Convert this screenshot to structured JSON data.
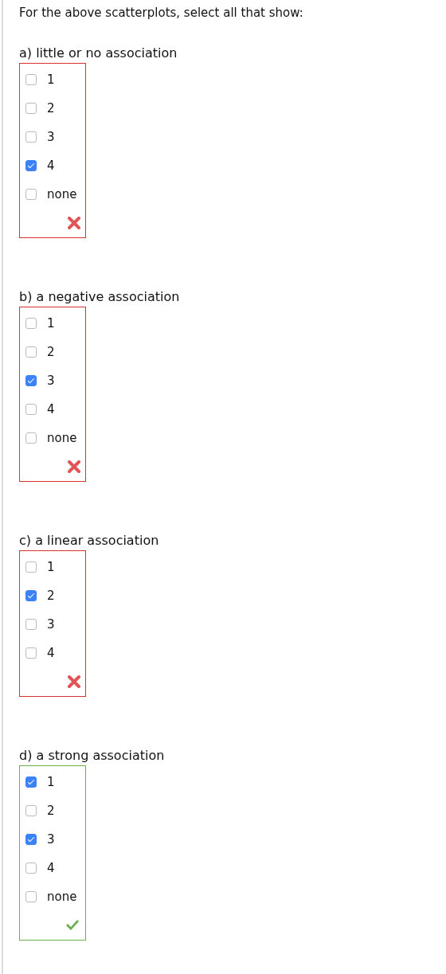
{
  "prompt": "For the above scatterplots, select all that show:",
  "parts": [
    {
      "label": "a) little or no association",
      "correct": false,
      "options": [
        {
          "label": "1",
          "checked": false
        },
        {
          "label": "2",
          "checked": false
        },
        {
          "label": "3",
          "checked": false
        },
        {
          "label": "4",
          "checked": true
        },
        {
          "label": "none",
          "checked": false
        }
      ]
    },
    {
      "label": "b) a negative association",
      "correct": false,
      "options": [
        {
          "label": "1",
          "checked": false
        },
        {
          "label": "2",
          "checked": false
        },
        {
          "label": "3",
          "checked": true
        },
        {
          "label": "4",
          "checked": false
        },
        {
          "label": "none",
          "checked": false
        }
      ]
    },
    {
      "label": "c) a linear association",
      "correct": false,
      "options": [
        {
          "label": "1",
          "checked": false
        },
        {
          "label": "2",
          "checked": true
        },
        {
          "label": "3",
          "checked": false
        },
        {
          "label": "4",
          "checked": false
        }
      ]
    },
    {
      "label": "d) a strong association",
      "correct": true,
      "options": [
        {
          "label": "1",
          "checked": true
        },
        {
          "label": "2",
          "checked": false
        },
        {
          "label": "3",
          "checked": true
        },
        {
          "label": "4",
          "checked": false
        },
        {
          "label": "none",
          "checked": false
        }
      ]
    }
  ]
}
